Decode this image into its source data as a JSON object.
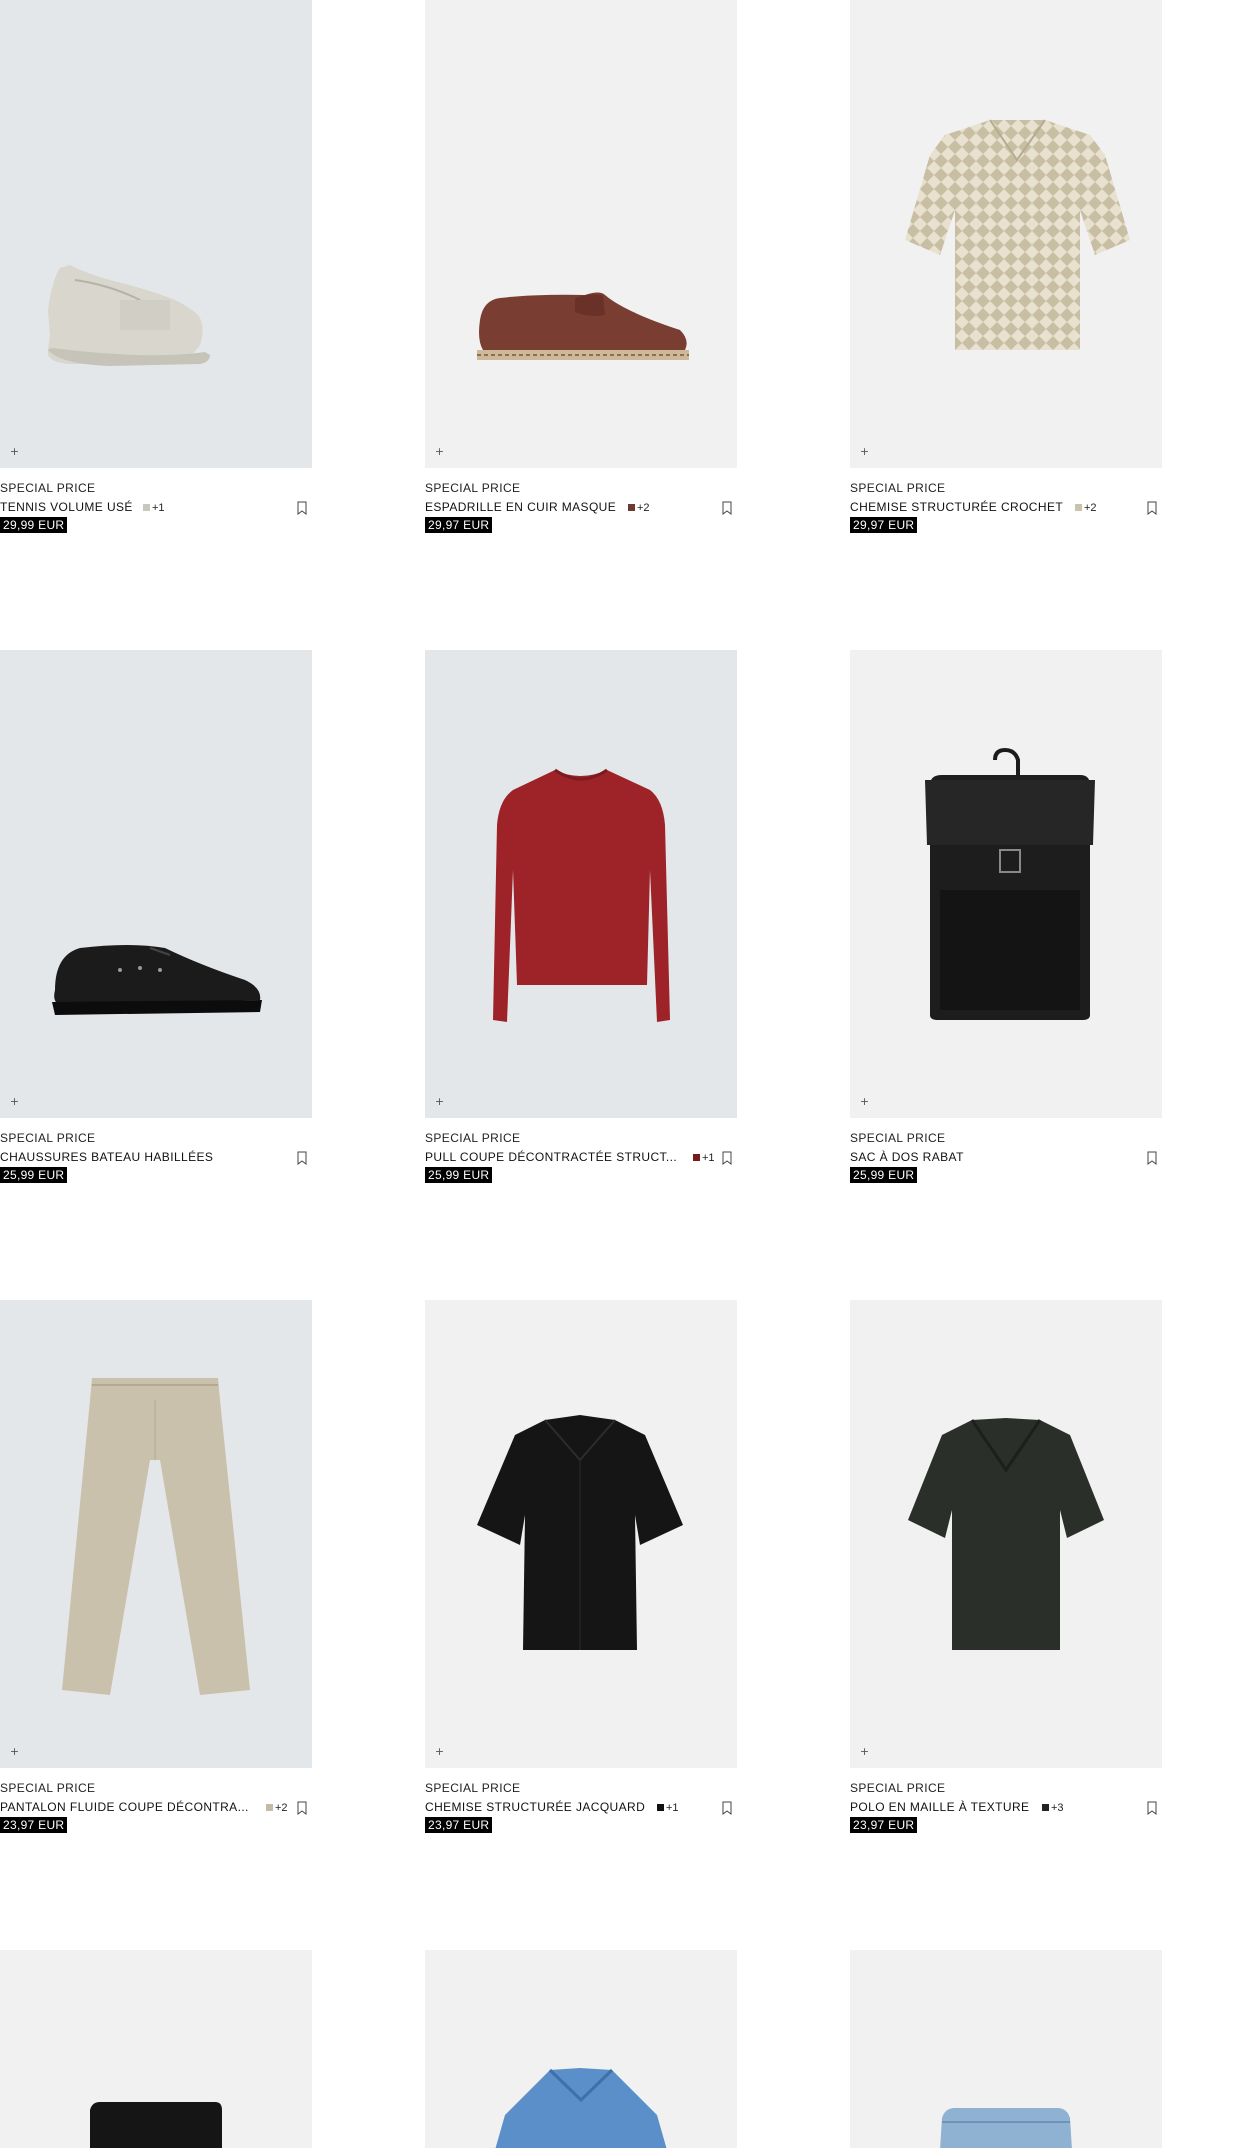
{
  "products": [
    {
      "badge": "SPECIAL PRICE",
      "name": "TENNIS VOLUME USÉ",
      "more": "+1",
      "swatch": "#c9c6bd",
      "price": "29,99 EUR",
      "icon": "sneaker-icon"
    },
    {
      "badge": "SPECIAL PRICE",
      "name": "ESPADRILLE EN CUIR MASQUE",
      "more": "+2",
      "swatch": "#6b3a30",
      "price": "29,97 EUR",
      "icon": "espadrille-icon"
    },
    {
      "badge": "SPECIAL PRICE",
      "name": "CHEMISE STRUCTURÉE CROCHET",
      "more": "+2",
      "swatch": "#c9c2ad",
      "price": "29,97 EUR",
      "icon": "shirt-icon"
    },
    {
      "badge": "SPECIAL PRICE",
      "name": "CHAUSSURES BATEAU HABILLÉES",
      "more": "",
      "swatch": "",
      "price": "25,99 EUR",
      "icon": "boat-shoe-icon"
    },
    {
      "badge": "SPECIAL PRICE",
      "name": "PULL COUPE DÉCONTRACTÉE STRUCT...",
      "more": "+1",
      "swatch": "#7a1b1b",
      "price": "25,99 EUR",
      "icon": "sweater-icon"
    },
    {
      "badge": "SPECIAL PRICE",
      "name": "SAC À DOS RABAT",
      "more": "",
      "swatch": "",
      "price": "25,99 EUR",
      "icon": "backpack-icon"
    },
    {
      "badge": "SPECIAL PRICE",
      "name": "PANTALON FLUIDE COUPE DÉCONTRA...",
      "more": "+2",
      "swatch": "#c3bba6",
      "price": "23,97 EUR",
      "icon": "trousers-icon"
    },
    {
      "badge": "SPECIAL PRICE",
      "name": "CHEMISE STRUCTURÉE JACQUARD",
      "more": "+1",
      "swatch": "#111111",
      "price": "23,97 EUR",
      "icon": "shirt-icon"
    },
    {
      "badge": "SPECIAL PRICE",
      "name": "POLO EN MAILLE À TEXTURE",
      "more": "+3",
      "swatch": "#222222",
      "price": "23,97 EUR",
      "icon": "polo-icon"
    },
    {
      "badge": "",
      "name": "",
      "more": "",
      "swatch": "",
      "price": "",
      "icon": "shorts-icon"
    },
    {
      "badge": "",
      "name": "",
      "more": "",
      "swatch": "",
      "price": "",
      "icon": "polo-icon"
    },
    {
      "badge": "",
      "name": "",
      "more": "",
      "swatch": "",
      "price": "",
      "icon": "jeans-icon"
    }
  ]
}
